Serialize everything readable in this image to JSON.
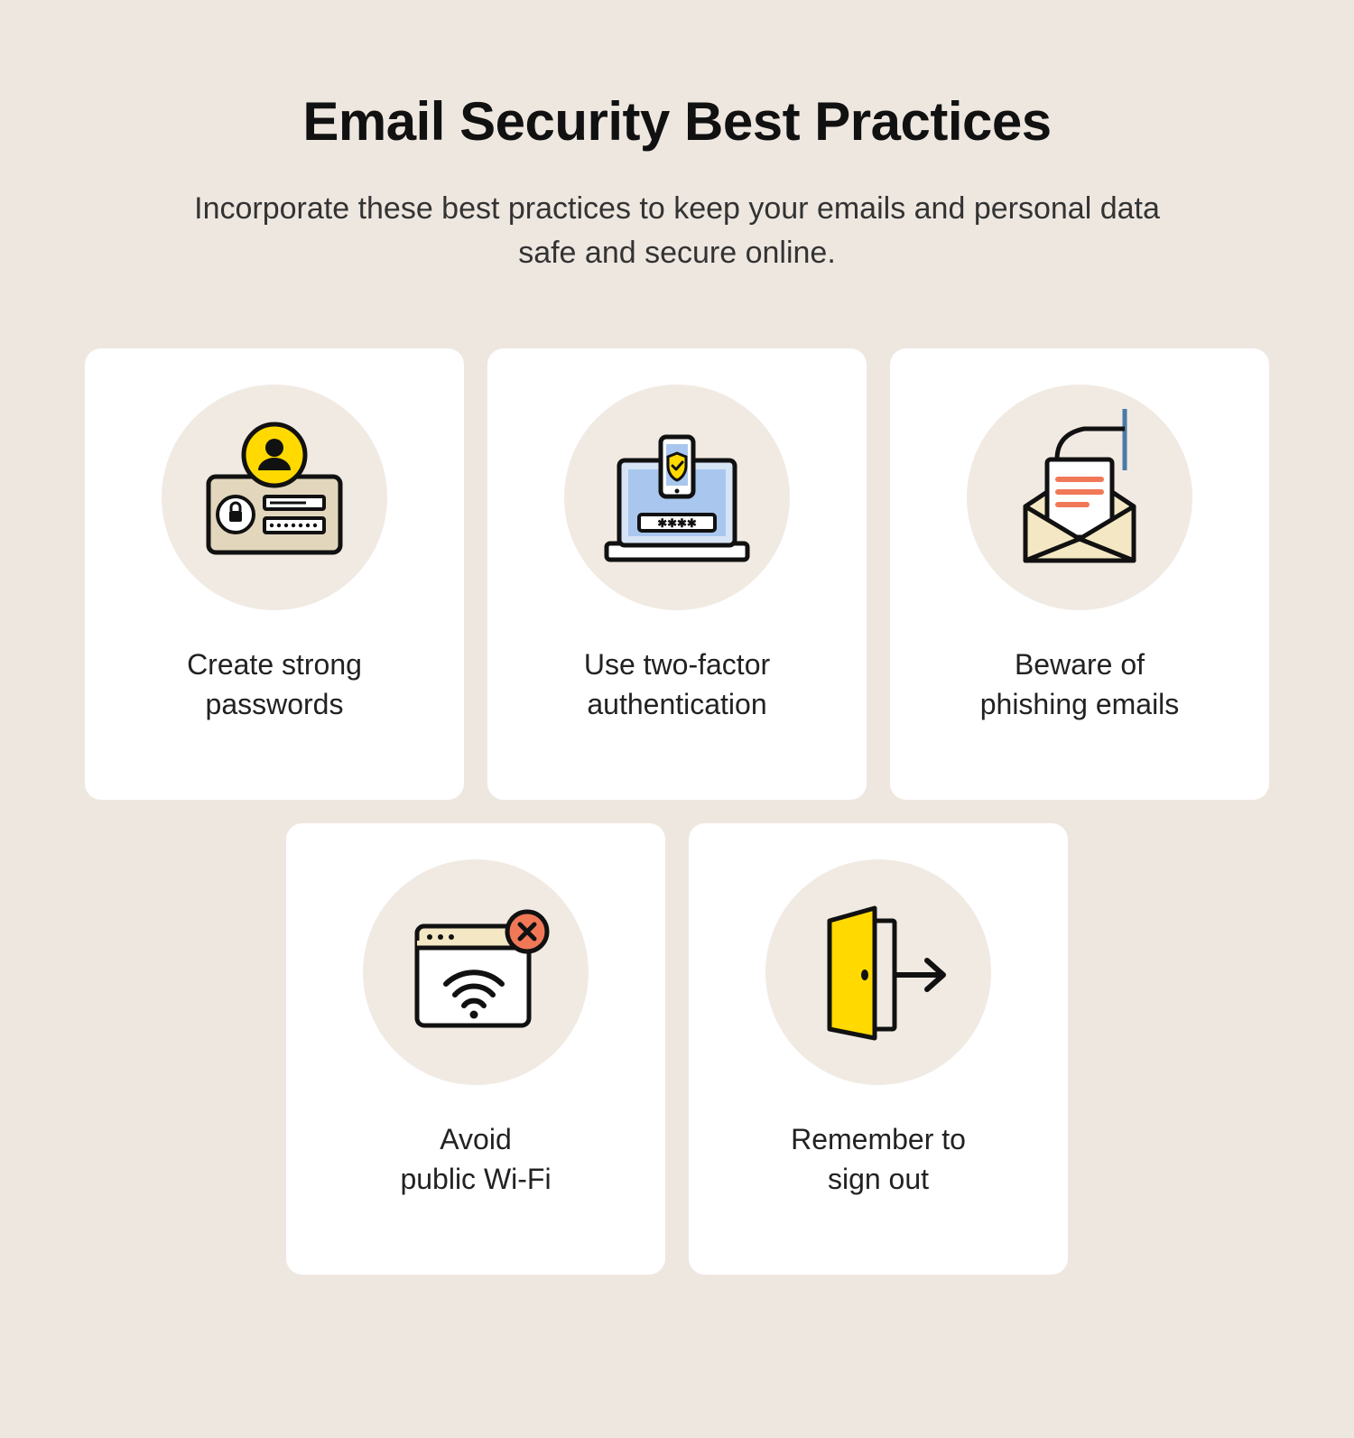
{
  "title": "Email Security Best Practices",
  "subtitle": "Incorporate these best practices to keep your emails and personal data safe and secure online.",
  "cards": [
    {
      "label": "Create strong\npasswords",
      "icon": "password-icon"
    },
    {
      "label": "Use two-factor\nauthentication",
      "icon": "two-factor-icon"
    },
    {
      "label": "Beware of\nphishing emails",
      "icon": "phishing-icon"
    },
    {
      "label": "Avoid\npublic Wi-Fi",
      "icon": "wifi-icon"
    },
    {
      "label": "Remember to\nsign out",
      "icon": "signout-icon"
    }
  ],
  "colors": {
    "bg": "#eee7e0",
    "card": "#ffffff",
    "iconBg": "#f1eae3",
    "yellow": "#ffd900",
    "blue": "#a9c7ee",
    "lightBlue": "#d6e4f5",
    "cream": "#f4e8c4",
    "red": "#f17857",
    "stroke": "#111111"
  }
}
